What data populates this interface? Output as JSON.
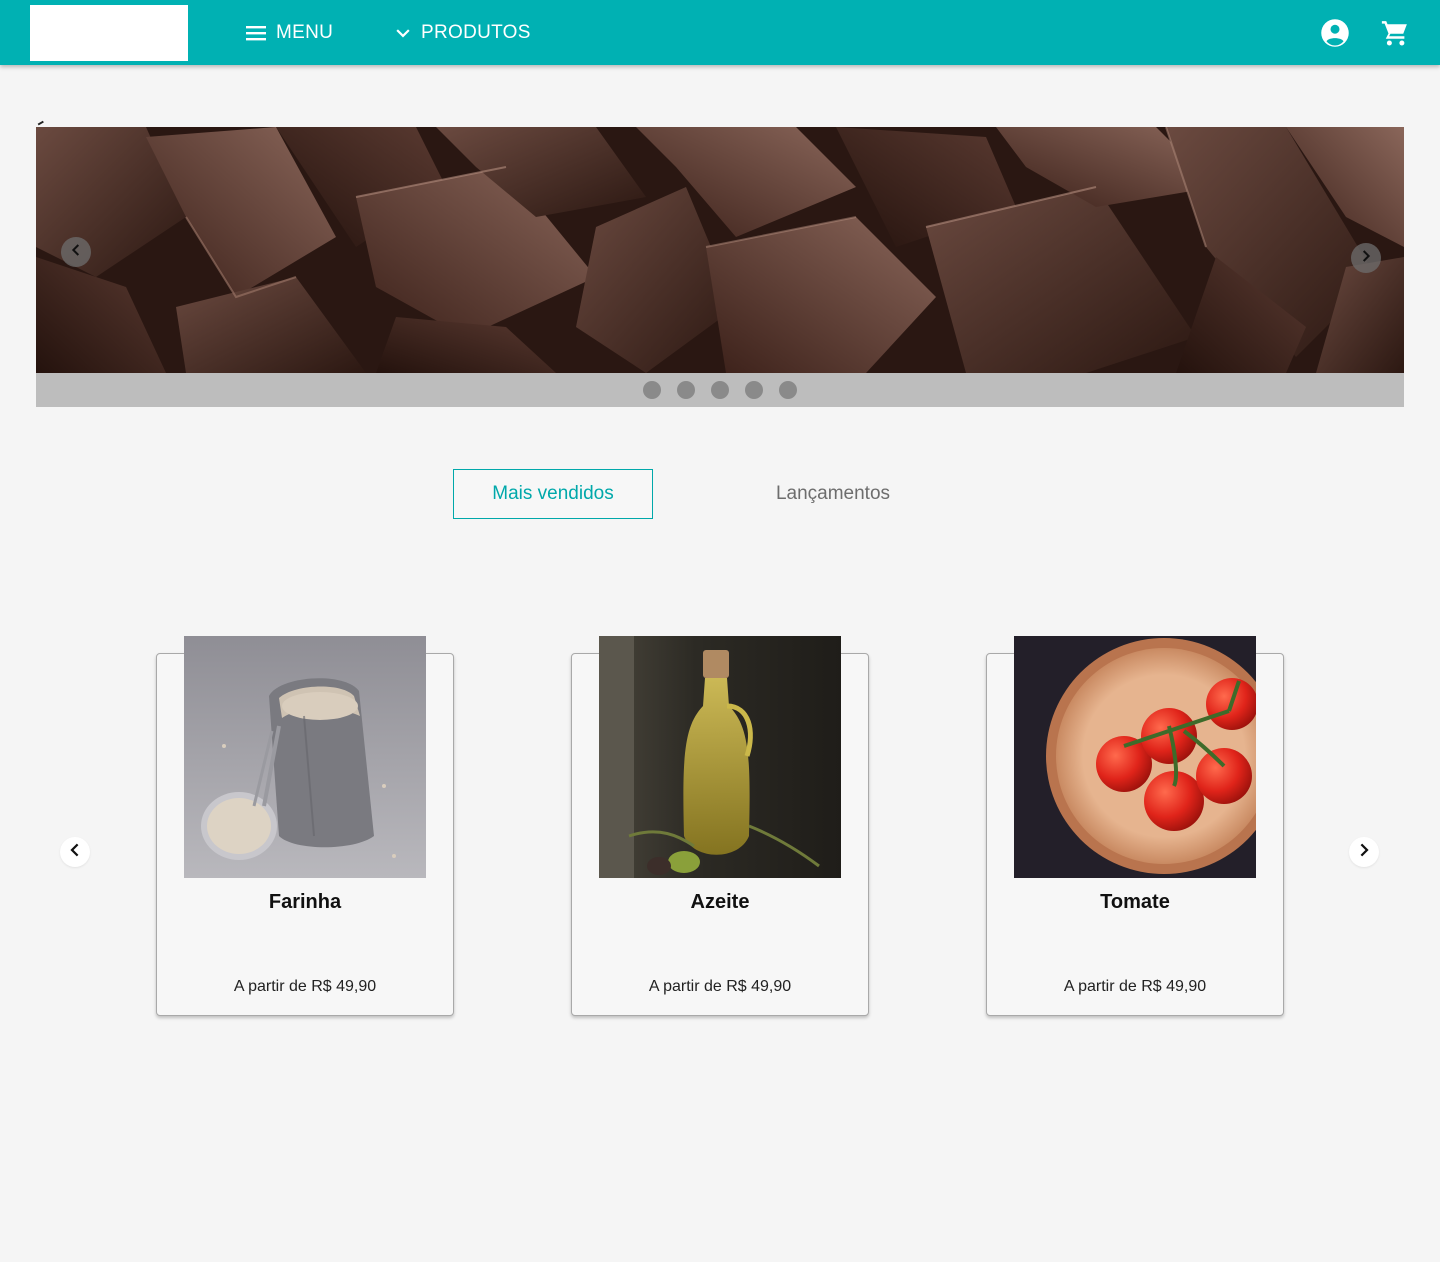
{
  "header": {
    "menu_label": "MENU",
    "products_label": "PRODUTOS",
    "icons": [
      "menu-icon",
      "chevron-down-icon",
      "account-circle-icon",
      "shopping-cart-icon"
    ],
    "brand_color": "#00b1b3"
  },
  "hero": {
    "image": "chocolate-pieces",
    "slide_count": 5,
    "icons": [
      "chevron-left-icon",
      "chevron-right-icon"
    ]
  },
  "tabs": [
    {
      "label": "Mais vendidos",
      "active": true
    },
    {
      "label": "Lançamentos",
      "active": false
    }
  ],
  "products": [
    {
      "name": "Farinha",
      "price": "A partir de R$ 49,90",
      "image": "flour-bag"
    },
    {
      "name": "Azeite",
      "price": "A partir de R$ 49,90",
      "image": "olive-oil-bottle"
    },
    {
      "name": "Tomate",
      "price": "A partir de R$ 49,90",
      "image": "tomatoes-bowl"
    }
  ],
  "colors": {
    "accent": "#00a8aa",
    "page_background": "#f5f5f5",
    "dot_indicator": "#8a8a8a"
  }
}
